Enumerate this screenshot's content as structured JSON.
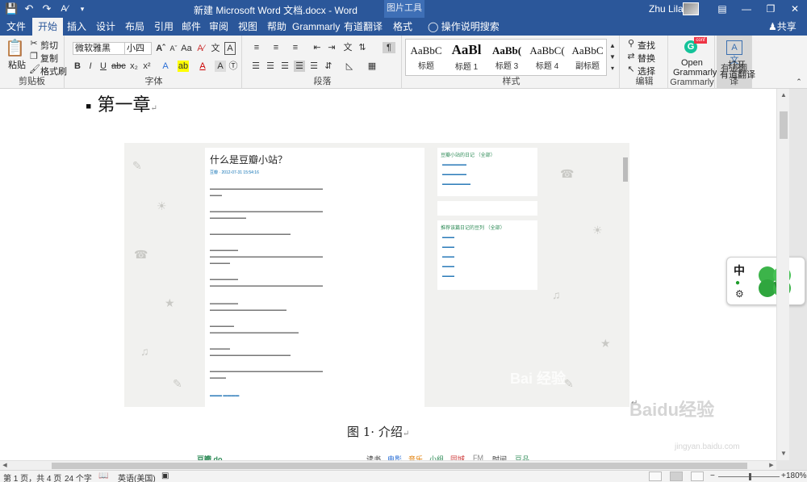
{
  "titlebar": {
    "title": "新建 Microsoft Word 文档.docx - Word",
    "context_tab": "图片工具",
    "user": "Zhu Lilan",
    "qat_icons": [
      "save-icon",
      "undo-icon",
      "redo-icon",
      "font-color-icon",
      "customize-icon"
    ]
  },
  "tabs": [
    {
      "label": "文件",
      "active": false
    },
    {
      "label": "开始",
      "active": true
    },
    {
      "label": "插入",
      "active": false
    },
    {
      "label": "设计",
      "active": false
    },
    {
      "label": "布局",
      "active": false
    },
    {
      "label": "引用",
      "active": false
    },
    {
      "label": "邮件",
      "active": false
    },
    {
      "label": "审阅",
      "active": false
    },
    {
      "label": "视图",
      "active": false
    },
    {
      "label": "帮助",
      "active": false
    },
    {
      "label": "Grammarly",
      "active": false
    },
    {
      "label": "有道翻译",
      "active": false
    },
    {
      "label": "格式",
      "active": false
    }
  ],
  "tellme": "操作说明搜索",
  "share": "共享",
  "ribbon": {
    "clipboard": {
      "label": "剪贴板",
      "paste": "粘贴",
      "cut": "剪切",
      "copy": "复制",
      "format_painter": "格式刷"
    },
    "font": {
      "label": "字体",
      "font_name": "微软雅黑",
      "font_size": "小四"
    },
    "paragraph": {
      "label": "段落"
    },
    "styles": {
      "label": "样式",
      "items": [
        {
          "sample": "AaBbC",
          "name": "标题"
        },
        {
          "sample": "AaBl",
          "name": "标题 1"
        },
        {
          "sample": "AaBb(",
          "name": "标题 3"
        },
        {
          "sample": "AaBbC(",
          "name": "标题 4"
        },
        {
          "sample": "AaBbC",
          "name": "副标题"
        }
      ]
    },
    "editing": {
      "label": "编辑",
      "find": "查找",
      "replace": "替换",
      "select": "选择"
    },
    "grammarly": {
      "label": "Grammarly",
      "open_line1": "Open",
      "open_line2": "Grammarly",
      "badge": "conf"
    },
    "youdao": {
      "label": "有道翻译",
      "open_line1": "打开",
      "open_line2": "有道翻译"
    }
  },
  "document": {
    "heading": "第一章",
    "caption": "图 1· 介绍",
    "image": {
      "article_title": "什么是豆瓣小站？",
      "article_meta": "豆瓣 · 2012-07-31 15:54:16",
      "side1_title": "豆瓣小站的日记 （全部）",
      "side2_title": "推荐该篇日记的豆列 （全部）",
      "watermark": "Bai 经验"
    },
    "strip": [
      "豆瓣 do",
      "读书",
      "电影",
      "音乐",
      "小组",
      "同城",
      "FM",
      "时间",
      "豆品"
    ]
  },
  "floating_widget": {
    "char": "中"
  },
  "watermark_corner": {
    "text": "Baidu经验",
    "url": "jingyan.baidu.com"
  },
  "statusbar": {
    "page": "第 1 页，共 4 页",
    "words": "24 个字",
    "language": "英语(美国)",
    "zoom": "180%",
    "zoom_minus": "−",
    "zoom_plus": "+"
  }
}
